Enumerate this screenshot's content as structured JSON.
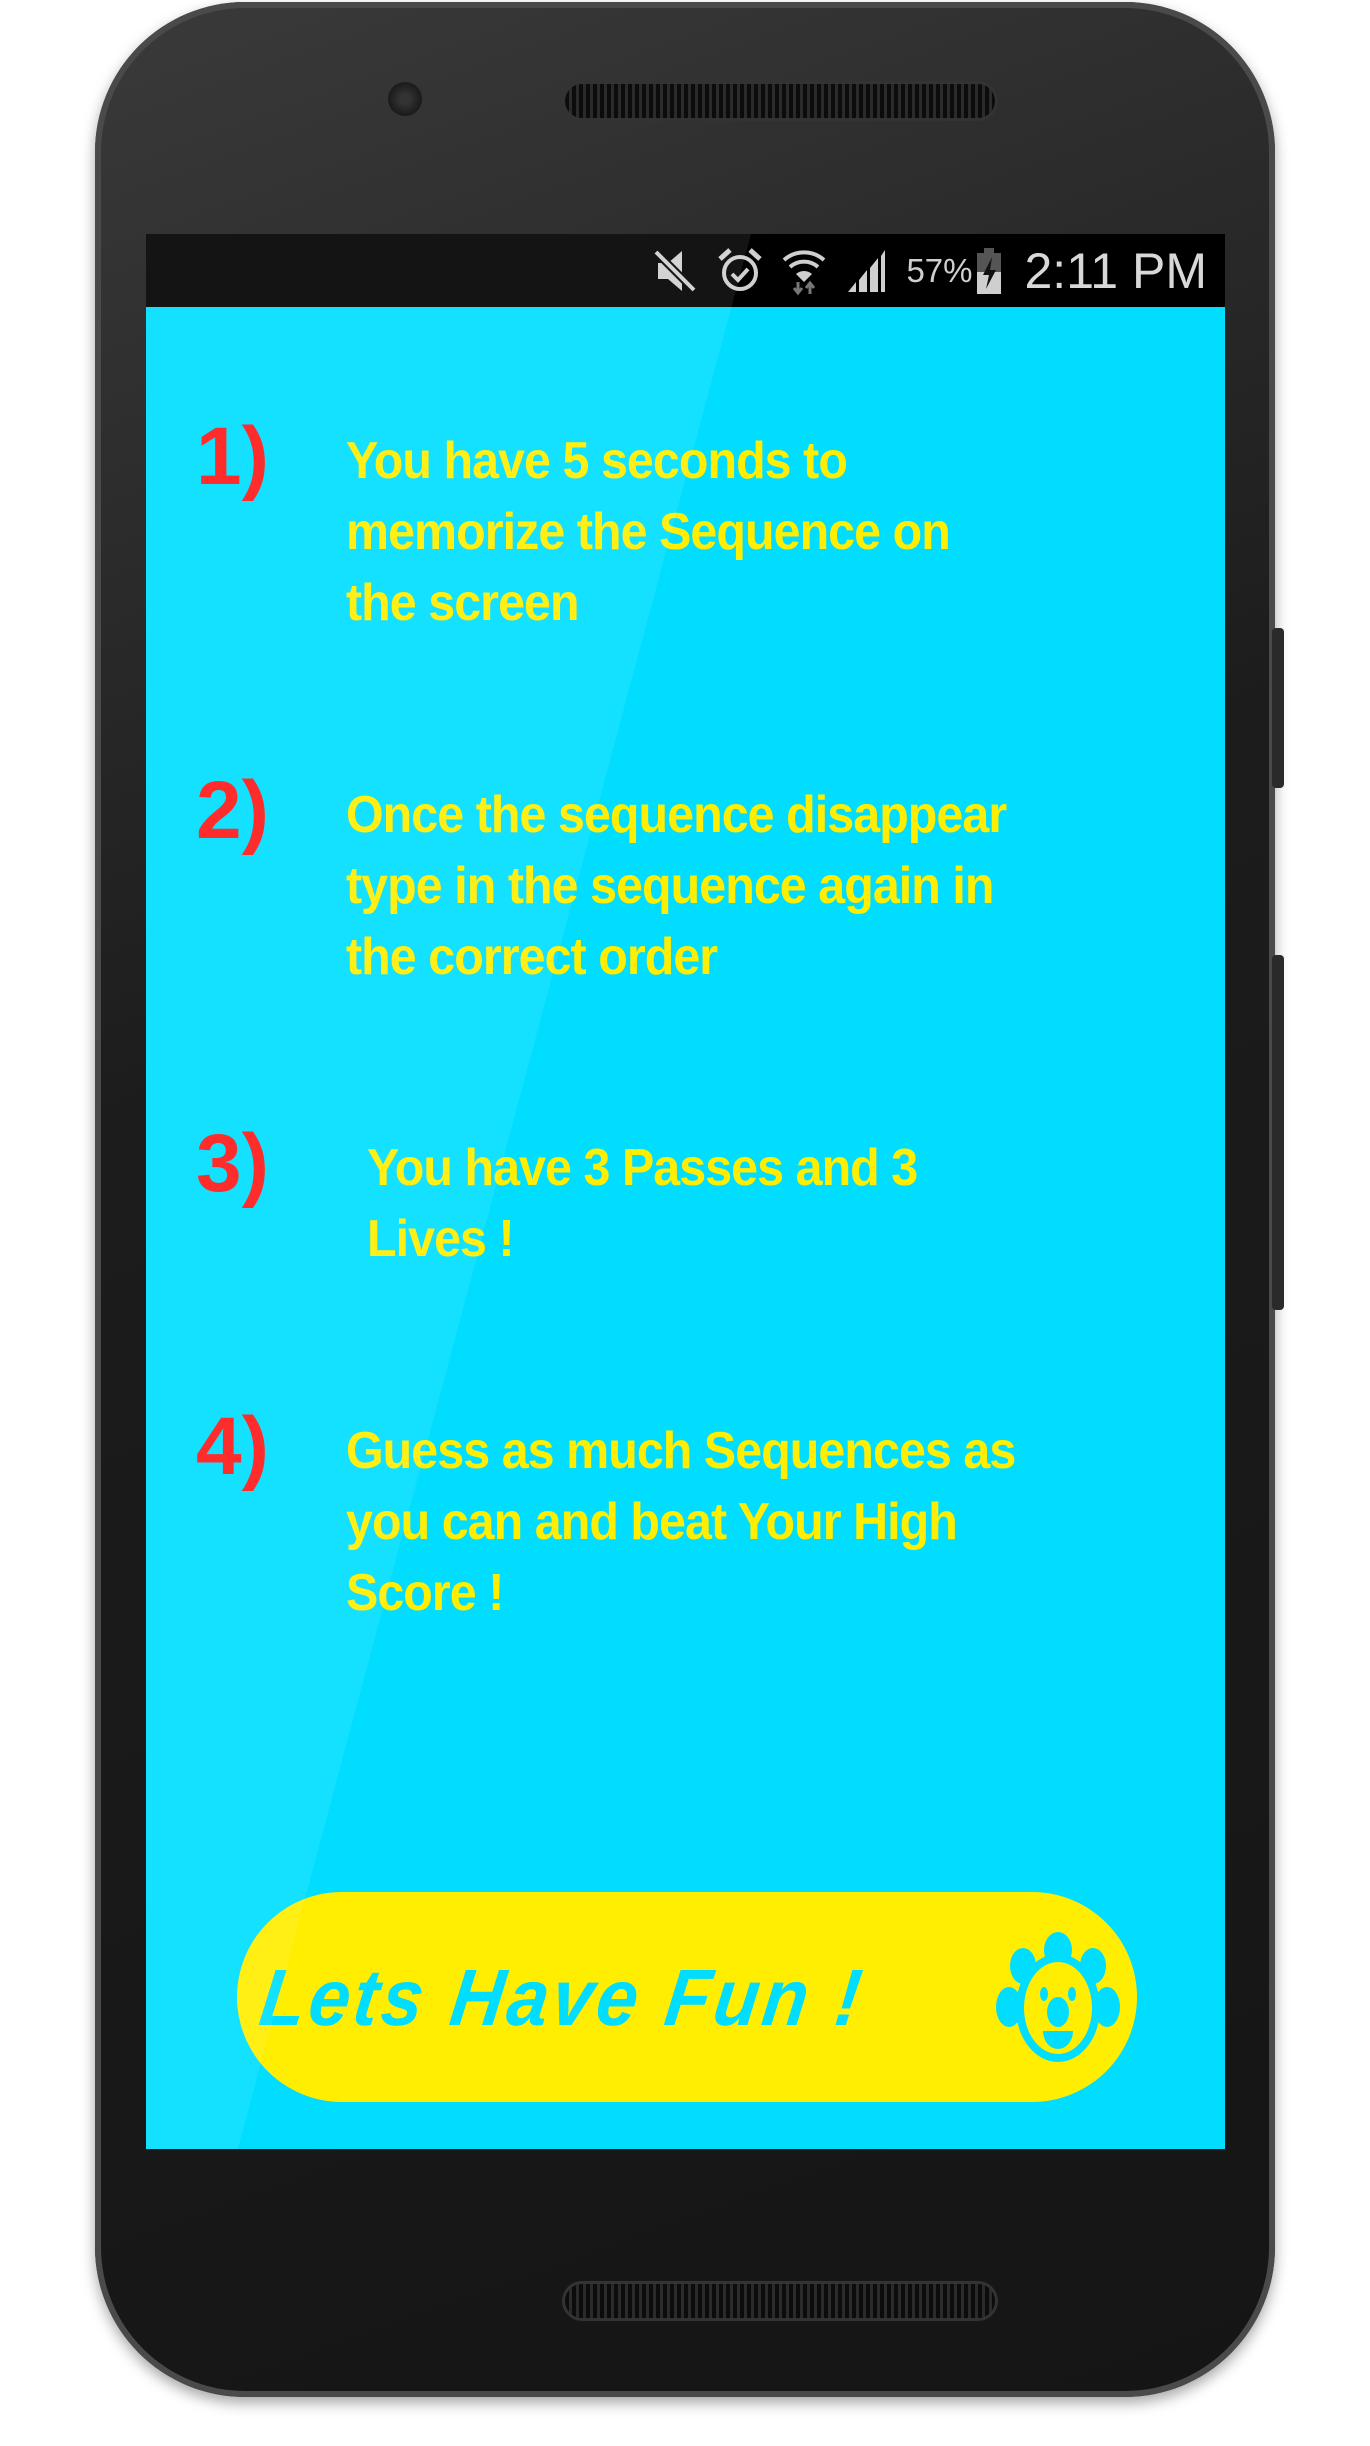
{
  "status_bar": {
    "icons": [
      "mute-icon",
      "alarm-icon",
      "wifi-icon",
      "signal-icon",
      "battery-charging-icon"
    ],
    "battery": "57%",
    "time": "2:11 PM"
  },
  "instructions": [
    {
      "number": "1)",
      "lines": [
        "You have 5 seconds to",
        "memorize the Sequence on",
        "the screen"
      ]
    },
    {
      "number": "2)",
      "lines": [
        "Once the sequence disappear",
        "type in the sequence again in",
        "the correct order"
      ]
    },
    {
      "number": "3)",
      "lines": [
        "You have 3 Passes and 3",
        "Lives !"
      ]
    },
    {
      "number": "4)",
      "lines": [
        "Guess as much Sequences as",
        "you can and beat Your High",
        "Score !"
      ]
    }
  ],
  "start_button": {
    "label": "Lets Have Fun !",
    "icon": "clown-flower-icon"
  },
  "colors": {
    "background": "#00DDFF",
    "text": "#FFEE00",
    "number": "#FF1A1A",
    "button": "#FFEE00"
  }
}
